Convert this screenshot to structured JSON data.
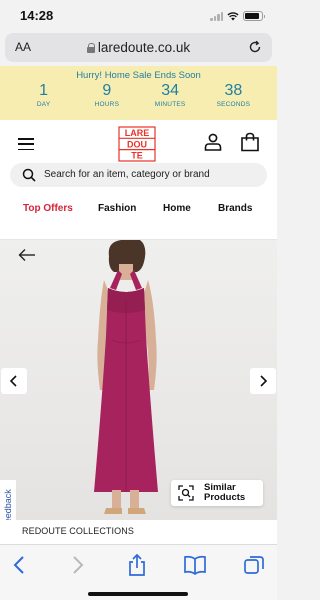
{
  "status_bar": {
    "time": "14:28",
    "battery_level": 0.85
  },
  "browser": {
    "text_size_button": "AA",
    "url": "laredoute.co.uk"
  },
  "banner": {
    "title": "Hurry! Home Sale Ends Soon",
    "countdown": [
      {
        "value": "1",
        "label": "DAY"
      },
      {
        "value": "9",
        "label": "HOURS"
      },
      {
        "value": "34",
        "label": "MINUTES"
      },
      {
        "value": "38",
        "label": "SECONDS"
      }
    ],
    "background": "#f8edb0",
    "text_color": "#1f7fa6"
  },
  "header": {
    "logo_lines": [
      "LARE",
      "DOU",
      "TE"
    ],
    "logo_color": "#e8322a",
    "search_placeholder": "Search for an item, category or brand"
  },
  "nav": {
    "items": [
      "Top Offers",
      "Fashion",
      "Home",
      "Brands"
    ],
    "highlight_color": "#d5253c"
  },
  "product": {
    "similar_button": "Similar Products",
    "feedback_label": "Feedback",
    "brand": "REDOUTE COLLECTIONS",
    "dress_color": "#a6235d"
  },
  "icons": [
    "reload-icon",
    "hamburger-icon",
    "account-icon",
    "bag-icon",
    "search-icon",
    "back-arrow-icon",
    "chevron-left-icon",
    "chevron-right-icon",
    "similar-search-icon",
    "browser-back-icon",
    "browser-forward-icon",
    "share-icon",
    "bookmarks-icon",
    "tabs-icon"
  ]
}
